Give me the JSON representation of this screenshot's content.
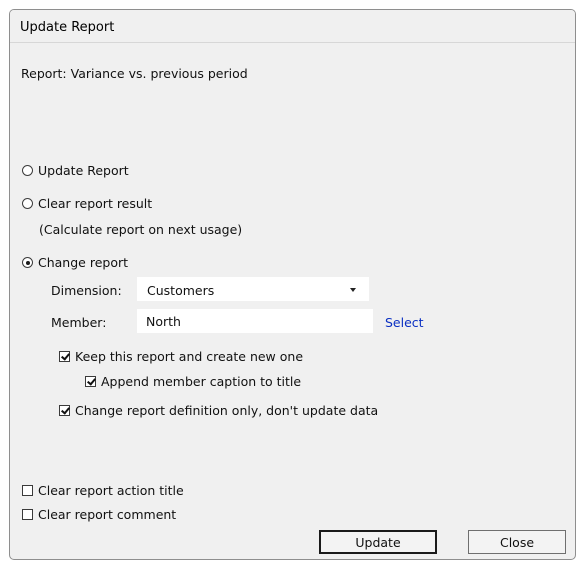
{
  "window": {
    "title": "Update Report"
  },
  "report": {
    "label": "Report: Variance vs. previous period"
  },
  "options": {
    "update_report": "Update Report",
    "clear_result": "Clear report result",
    "clear_result_note": "(Calculate report on next usage)",
    "change_report": "Change report",
    "selected": "change_report"
  },
  "change": {
    "dimension_label": "Dimension:",
    "dimension_value": "Customers",
    "member_label": "Member:",
    "member_value": "North",
    "select_link": "Select"
  },
  "checks": {
    "keep_report": {
      "label": "Keep this report and create new one",
      "checked": true
    },
    "append_caption": {
      "label": "Append member caption to title",
      "checked": true
    },
    "definition_only": {
      "label": "Change report definition only, don't update data",
      "checked": true
    },
    "clear_action_title": {
      "label": "Clear report action title",
      "checked": false
    },
    "clear_comment": {
      "label": "Clear report comment",
      "checked": false
    }
  },
  "buttons": {
    "update": "Update",
    "close": "Close"
  },
  "colors": {
    "dialog_bg": "#f0f0f0",
    "link": "#0a2fc2",
    "field_bg": "#ffffff"
  },
  "icons": {
    "dropdown": "chevron-down-icon"
  }
}
